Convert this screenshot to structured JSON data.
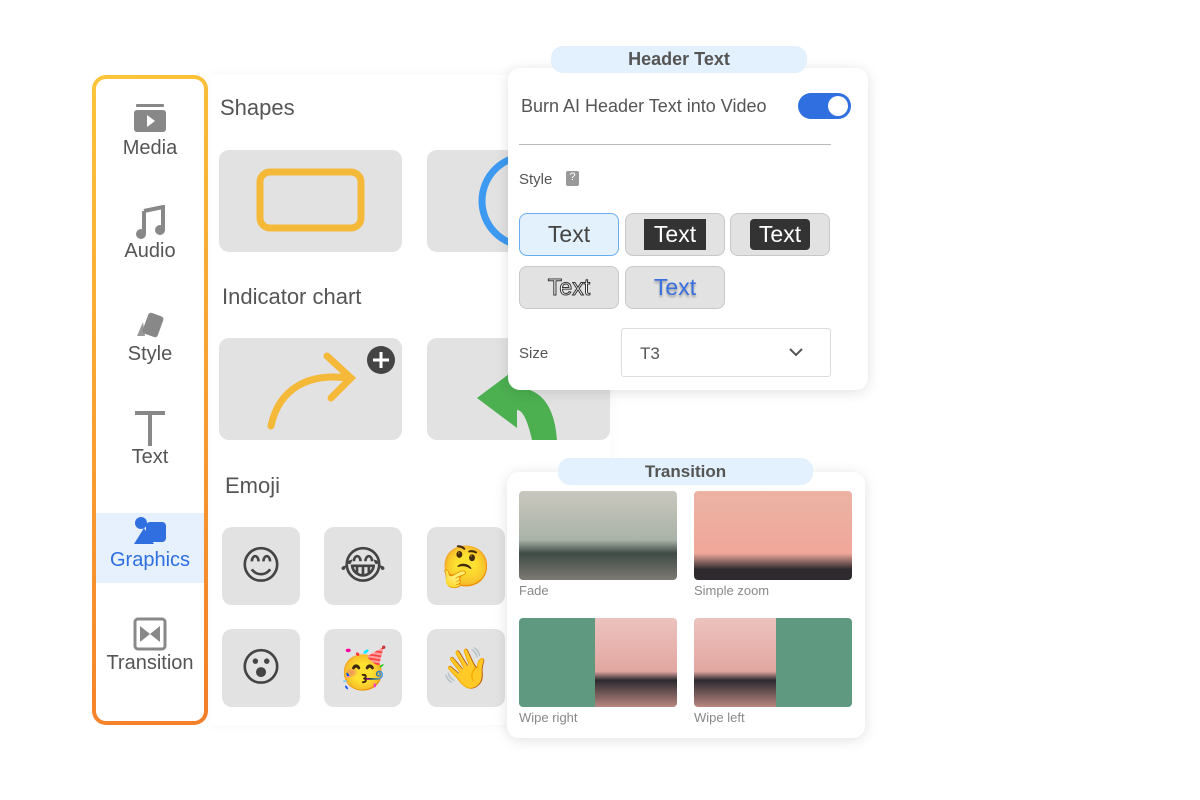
{
  "sidebar": {
    "items": [
      {
        "label": "Media",
        "icon": "media-icon"
      },
      {
        "label": "Audio",
        "icon": "music-note-icon"
      },
      {
        "label": "Style",
        "icon": "style-swatch-icon"
      },
      {
        "label": "Text",
        "icon": "text-icon"
      },
      {
        "label": "Graphics",
        "icon": "graphics-icon",
        "active": true
      },
      {
        "label": "Transition",
        "icon": "transition-icon"
      }
    ]
  },
  "main": {
    "sections": {
      "shapes": "Shapes",
      "indicator": "Indicator chart",
      "emoji": "Emoji"
    },
    "emojis": [
      "😊",
      "😂",
      "🤔",
      "😮",
      "🥳",
      "👋"
    ]
  },
  "header_panel": {
    "title": "Header Text",
    "burn_label": "Burn AI Header Text into Video",
    "burn_enabled": true,
    "style_label": "Style",
    "styles": [
      "Text",
      "Text",
      "Text",
      "Text",
      "Text"
    ],
    "selected_style": 0,
    "size_label": "Size",
    "size_value": "T3"
  },
  "transition_panel": {
    "title": "Transition",
    "items": [
      "Fade",
      "Simple zoom",
      "Wipe right",
      "Wipe left"
    ]
  },
  "colors": {
    "accent": "#2f6fe0",
    "orange": "#f5b93a",
    "border_top": "#fbc53a",
    "border_bottom": "#f57f2a"
  }
}
